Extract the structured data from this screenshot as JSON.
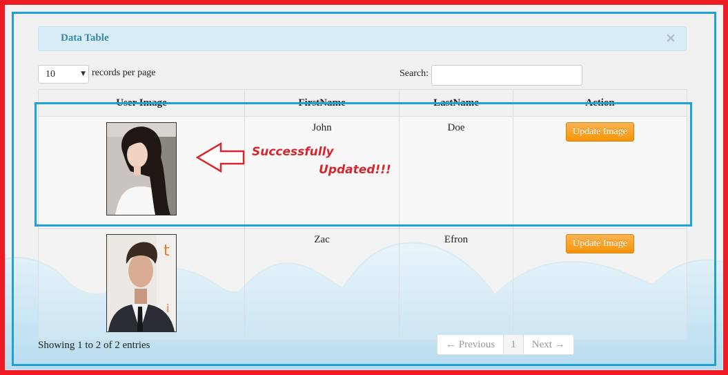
{
  "panel": {
    "title": "Data Table",
    "close_glyph": "×"
  },
  "controls": {
    "length_value": "10",
    "length_label": "records per page",
    "search_label": "Search:",
    "search_value": ""
  },
  "table": {
    "columns": [
      "User Image",
      "FirstName",
      "LastName",
      "Action"
    ],
    "rows": [
      {
        "first": "John",
        "last": "Doe",
        "action": "Update Image"
      },
      {
        "first": "Zac",
        "last": "Efron",
        "action": "Update Image"
      }
    ]
  },
  "annotation": {
    "line1": "Successfully",
    "line2": "Updated!!!"
  },
  "footer": {
    "info": "Showing 1 to 2 of 2 entries",
    "prev": "← Previous",
    "page": "1",
    "next": "Next →"
  },
  "colors": {
    "accent_border": "#1ea0db",
    "annotation_red": "#d7262e",
    "button_orange": "#f89406"
  }
}
